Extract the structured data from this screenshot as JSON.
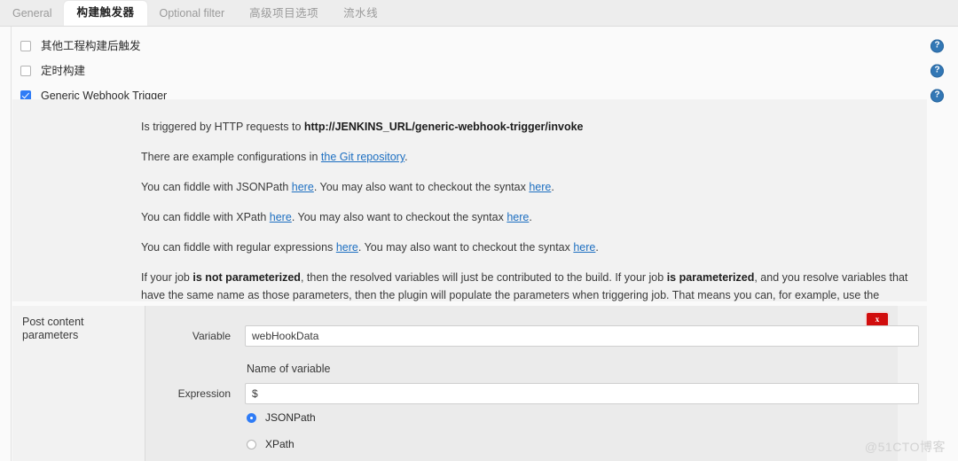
{
  "tabs": [
    {
      "label": "General",
      "active": false
    },
    {
      "label": "构建触发器",
      "active": true
    },
    {
      "label": "Optional filter",
      "active": false
    },
    {
      "label": "高级项目选项",
      "active": false
    },
    {
      "label": "流水线",
      "active": false
    }
  ],
  "triggers": [
    {
      "label": "其他工程构建后触发",
      "checked": false,
      "help": "?"
    },
    {
      "label": "定时构建",
      "checked": false,
      "help": "?"
    },
    {
      "label": "Generic Webhook Trigger",
      "checked": true,
      "help": "?"
    }
  ],
  "description": {
    "line1_pre": "Is triggered by HTTP requests to ",
    "line1_url": "http://JENKINS_URL/generic-webhook-trigger/invoke",
    "line2_pre": "There are example configurations in ",
    "line2_link": "the Git repository",
    "line2_post": ".",
    "line3_pre": "You can fiddle with JSONPath ",
    "line3_link1": "here",
    "line3_mid": ". You may also want to checkout the syntax ",
    "line3_link2": "here",
    "line3_post": ".",
    "line4_pre": "You can fiddle with XPath ",
    "line4_link1": "here",
    "line4_mid": ". You may also want to checkout the syntax ",
    "line4_link2": "here",
    "line4_post": ".",
    "line5_pre": "You can fiddle with regular expressions ",
    "line5_link1": "here",
    "line5_mid": ". You may also want to checkout the syntax ",
    "line5_link2": "here",
    "line5_post": ".",
    "para_pre": "If your job ",
    "para_bold1": "is not parameterized",
    "para_mid1": ", then the resolved variables will just be contributed to the build. If your job ",
    "para_bold2": "is parameterized",
    "para_mid2": ", and you resolve variables that have the same name as those parameters, then the plugin will populate the parameters when triggering job. That means you can, for example, use the parameters in combination with an SCM plugin, like GIT Plugin, to pick a branch."
  },
  "post_content_parameters": {
    "section_label": "Post content parameters",
    "delete_label": "x",
    "variable": {
      "label": "Variable",
      "value": "webHookData",
      "placeholder": "",
      "help_text": "Name of variable"
    },
    "expression": {
      "label": "Expression",
      "value": "$",
      "placeholder": ""
    },
    "expression_type": [
      {
        "label": "JSONPath",
        "selected": true
      },
      {
        "label": "XPath",
        "selected": false
      }
    ]
  },
  "watermark": "@51CTO博客",
  "colors": {
    "accent_blue": "#2f7cf6",
    "link_blue": "#1d6fc1",
    "help_blue": "#3277b5",
    "danger_red": "#d10d0d",
    "panel_gray": "#f2f2f2",
    "inner_gray": "#ebebeb"
  }
}
